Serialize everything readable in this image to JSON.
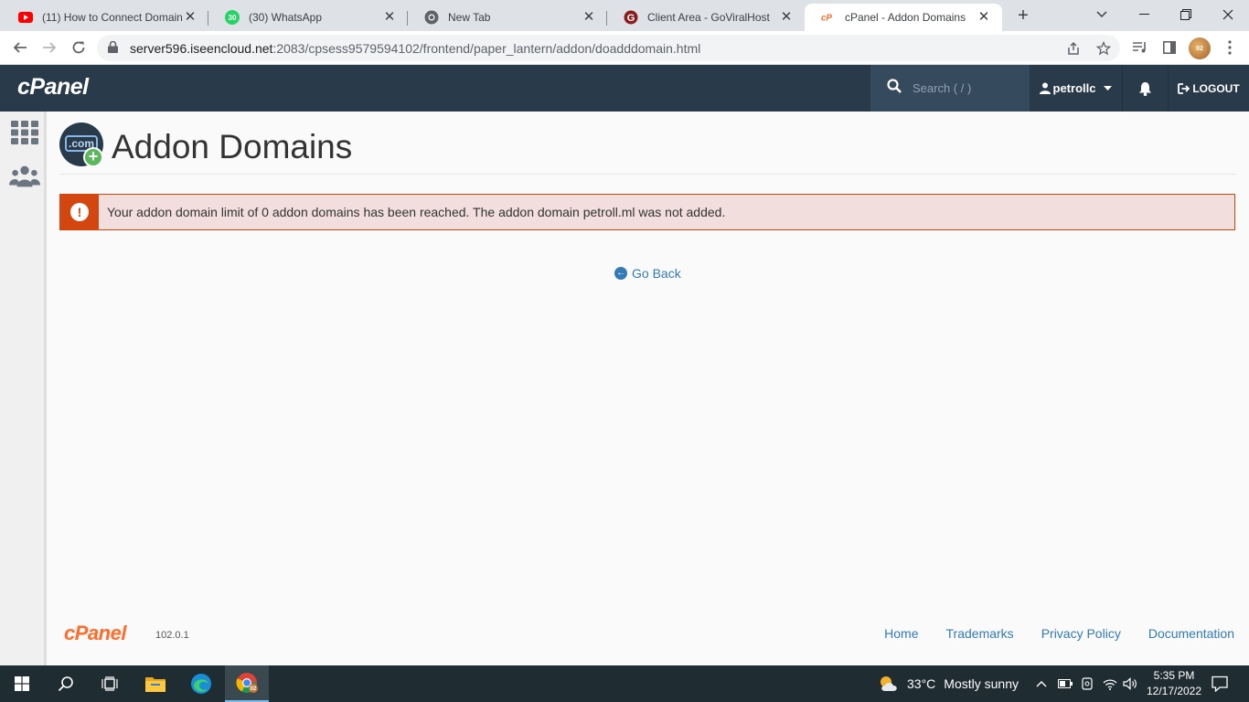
{
  "browser": {
    "tabs": [
      {
        "title": "(11) How to Connect Domain",
        "icon": "youtube-icon"
      },
      {
        "title": "(30) WhatsApp",
        "icon": "whatsapp-icon",
        "badge": "30"
      },
      {
        "title": "New Tab",
        "icon": "chrome-icon"
      },
      {
        "title": "Client Area - GoViralHost",
        "icon": "goviralhost-icon"
      },
      {
        "title": "cPanel - Addon Domains",
        "icon": "cpanel-icon",
        "active": true
      }
    ],
    "url_host": "server596.iseencloud.net",
    "url_rest": ":2083/cpsess9579594102/frontend/paper_lantern/addon/doadddomain.html",
    "profile_badge": "02"
  },
  "cpanel": {
    "logo": "cPanel",
    "search_placeholder": "Search ( / )",
    "username": "petrollc",
    "logout_label": "LOGOUT",
    "page_title": "Addon Domains",
    "page_icon_text": ".com",
    "alert_text": "Your addon domain limit of 0 addon domains has been reached. The addon domain petroll.ml was not added.",
    "go_back_label": "Go Back",
    "footer": {
      "logo": "cPanel",
      "version": "102.0.1",
      "links": [
        "Home",
        "Trademarks",
        "Privacy Policy",
        "Documentation"
      ]
    }
  },
  "taskbar": {
    "weather_temp": "33°C",
    "weather_text": "Mostly sunny",
    "time": "5:35 PM",
    "date": "12/17/2022",
    "chrome_badge": "02"
  },
  "colors": {
    "header_bg": "#293a4a",
    "alert_border": "#d4460f",
    "alert_bg": "#f2dedd",
    "link": "#337ab7",
    "cpanel_orange": "#ff6c2c"
  }
}
